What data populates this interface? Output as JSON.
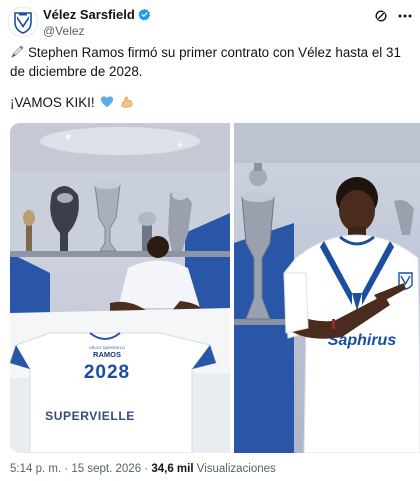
{
  "account": {
    "name": "Vélez Sarsfield",
    "handle": "@Velez",
    "verified_color": "#1d9bf0",
    "avatar_icon": "velez-crest-icon"
  },
  "header_icons": [
    "grok-icon",
    "more-options-icon"
  ],
  "tweet": {
    "line1": "Stephen Ramos firmó su primer contrato con Vélez hasta el 31 de diciembre de 2028.",
    "line2": "¡VAMOS KIKI!",
    "emojis": [
      "pen-emoji-icon",
      "blue-heart-emoji-icon",
      "flexed-biceps-emoji-icon"
    ]
  },
  "media": {
    "left_photo": {
      "shirt_name": "RAMOS",
      "shirt_number": "2028",
      "shirt_sponsor": "SUPERVIELLE",
      "shirt_tag": "VÉLEZ SARSFIELD"
    },
    "right_photo": {
      "shirt_sponsor": "Saphirus"
    }
  },
  "meta": {
    "time": "5:14 p. m.",
    "separator": "·",
    "date": "15 sept. 2026",
    "views_count": "34,6 mil",
    "views_label": "Visualizaciones"
  },
  "colors": {
    "accent": "#1d9bf0",
    "club_blue": "#1a4fa0",
    "text_secondary": "#536471"
  }
}
